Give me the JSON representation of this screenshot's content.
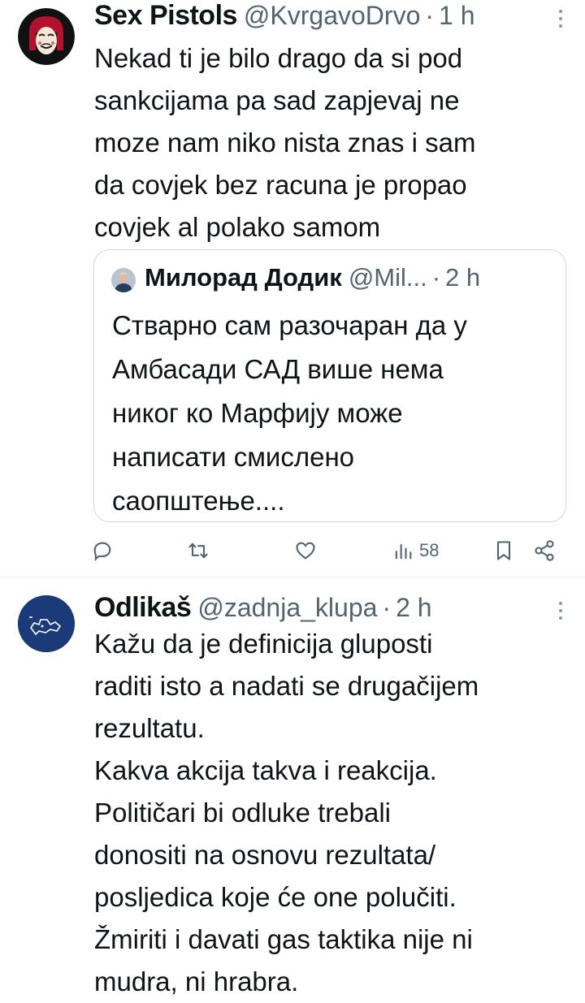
{
  "tweets": [
    {
      "name": "Sex Pistols",
      "handle": "@KvrgavoDrvo",
      "separator": "·",
      "time": "1 h",
      "text": "Nekad ti je bilo drago da si pod\nsankcijama pa sad zapjevaj ne\nmoze nam niko nista znas i sam\nda covjek bez racuna je propao\ncovjek al polako samom",
      "quote": {
        "name": "Милорад Додик",
        "handle": "@Mil...",
        "separator": "·",
        "time": "2 h",
        "text": "Стварно сам разочаран да у\nАмбасади САД више нема\nниког ко Марфију може\nнаписати смислено\nсаопштење...."
      },
      "actions": {
        "reply_icon": "reply-icon",
        "retweet_icon": "retweet-icon",
        "like_icon": "heart-icon",
        "views_icon": "views-icon",
        "views_count": "58",
        "bookmark_icon": "bookmark-icon",
        "share_icon": "share-icon"
      }
    },
    {
      "name": "Odlikaš",
      "handle": "@zadnja_klupa",
      "separator": "·",
      "time": "2 h",
      "text": "Kažu da je definicija gluposti\nraditi isto a nadati se drugačijem\nrezultatu.\nKakva akcija takva i reakcija.\nPolitičari bi odluke trebali\ndonositi na osnovu rezultata/\nposljedica koje će one polučiti.\nŽmiriti i davati gas taktika nije ni\nmudra, ni hrabra."
    }
  ],
  "colors": {
    "text": "#0f1419",
    "muted": "#536471",
    "border": "#cfd9de"
  }
}
